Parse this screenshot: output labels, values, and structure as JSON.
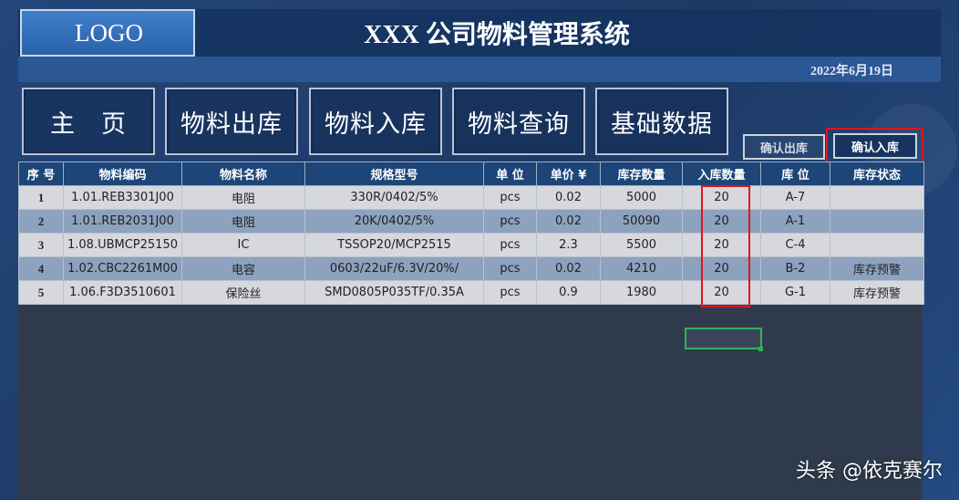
{
  "header": {
    "logo": "LOGO",
    "title": "XXX 公司物料管理系统",
    "date": "2022年6月19日"
  },
  "nav": {
    "home": "主　页",
    "outbound": "物料出库",
    "inbound": "物料入库",
    "query": "物料查询",
    "basic_data": "基础数据"
  },
  "actions": {
    "confirm_out": "确认出库",
    "confirm_in": "确认入库"
  },
  "table": {
    "headers": [
      "序 号",
      "物料编码",
      "物料名称",
      "规格型号",
      "单 位",
      "单价 ¥",
      "库存数量",
      "入库数量",
      "库 位",
      "库存状态"
    ],
    "rows": [
      [
        "1",
        "1.01.REB3301J00",
        "电阻",
        "330R/0402/5%",
        "pcs",
        "0.02",
        "5000",
        "20",
        "A-7",
        ""
      ],
      [
        "2",
        "1.01.REB2031J00",
        "电阻",
        "20K/0402/5%",
        "pcs",
        "0.02",
        "50090",
        "20",
        "A-1",
        ""
      ],
      [
        "3",
        "1.08.UBMCP25150",
        "IC",
        "TSSOP20/MCP2515",
        "pcs",
        "2.3",
        "5500",
        "20",
        "C-4",
        ""
      ],
      [
        "4",
        "1.02.CBC2261M00",
        "电容",
        "0603/22uF/6.3V/20%/",
        "pcs",
        "0.02",
        "4210",
        "20",
        "B-2",
        "库存预警"
      ],
      [
        "5",
        "1.06.F3D3510601",
        "保险丝",
        "SMD0805P035TF/0.35A",
        "pcs",
        "0.9",
        "1980",
        "20",
        "G-1",
        "库存预警"
      ]
    ]
  },
  "watermark": "头条 @依克赛尔",
  "colors": {
    "header_row": "#1d4577",
    "row_light": "#d7d8dd",
    "row_dark": "#8da2bf",
    "highlight": "#e1141d",
    "selection": "#2eb35a"
  }
}
